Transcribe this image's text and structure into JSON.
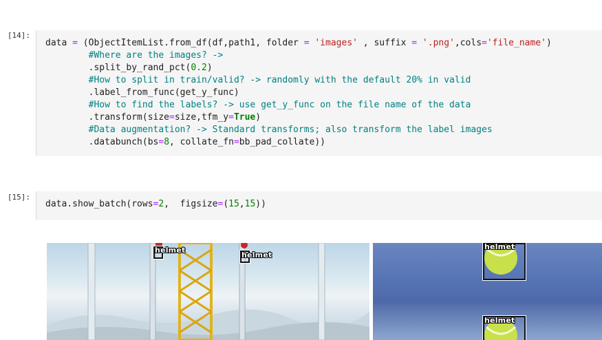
{
  "cells": [
    {
      "prompt": "[14]:",
      "lines": [
        [
          [
            "t",
            "data "
          ],
          [
            "op",
            "="
          ],
          [
            "t",
            " (ObjectItemList.from_df(df,path1, folder "
          ],
          [
            "op",
            "="
          ],
          [
            "t",
            " "
          ],
          [
            "str",
            "'images'"
          ],
          [
            "t",
            " , suffix "
          ],
          [
            "op",
            "="
          ],
          [
            "t",
            " "
          ],
          [
            "str",
            "'.png'"
          ],
          [
            "t",
            ",cols"
          ],
          [
            "op",
            "="
          ],
          [
            "str",
            "'file_name'"
          ],
          [
            "t",
            ")"
          ]
        ],
        [
          [
            "t",
            "        "
          ],
          [
            "cm",
            "#Where are the images? ->"
          ]
        ],
        [
          [
            "t",
            "        .split_by_rand_pct("
          ],
          [
            "num",
            "0.2"
          ],
          [
            "t",
            ")"
          ]
        ],
        [
          [
            "t",
            "        "
          ],
          [
            "cm",
            "#How to split in train/valid? -> randomly with the default 20% in valid"
          ]
        ],
        [
          [
            "t",
            "        .label_from_func(get_y_func)"
          ]
        ],
        [
          [
            "t",
            "        "
          ],
          [
            "cm",
            "#How to find the labels? -> use get_y_func on the file name of the data"
          ]
        ],
        [
          [
            "t",
            "        .transform(size"
          ],
          [
            "op",
            "="
          ],
          [
            "t",
            "size,tfm_y"
          ],
          [
            "op",
            "="
          ],
          [
            "kw",
            "True"
          ],
          [
            "t",
            ")"
          ]
        ],
        [
          [
            "t",
            "        "
          ],
          [
            "cm",
            "#Data augmentation? -> Standard transforms; also transform the label images"
          ]
        ],
        [
          [
            "t",
            "        .databunch(bs"
          ],
          [
            "op",
            "="
          ],
          [
            "num",
            "8"
          ],
          [
            "t",
            ", collate_fn"
          ],
          [
            "op",
            "="
          ],
          [
            "t",
            "bb_pad_collate))"
          ]
        ]
      ]
    },
    {
      "prompt": "[15]:",
      "lines": [
        [
          [
            "t",
            "data.show_batch(rows"
          ],
          [
            "op",
            "="
          ],
          [
            "num",
            "2"
          ],
          [
            "t",
            ",  figsize"
          ],
          [
            "op",
            "="
          ],
          [
            "t",
            "("
          ],
          [
            "num",
            "15"
          ],
          [
            "t",
            ","
          ],
          [
            "num",
            "15"
          ],
          [
            "t",
            "))"
          ]
        ]
      ]
    }
  ],
  "output": {
    "labels": {
      "left_1": "helmet",
      "left_2": "helmet",
      "right_1": "helmet",
      "right_2": "helmet"
    }
  }
}
